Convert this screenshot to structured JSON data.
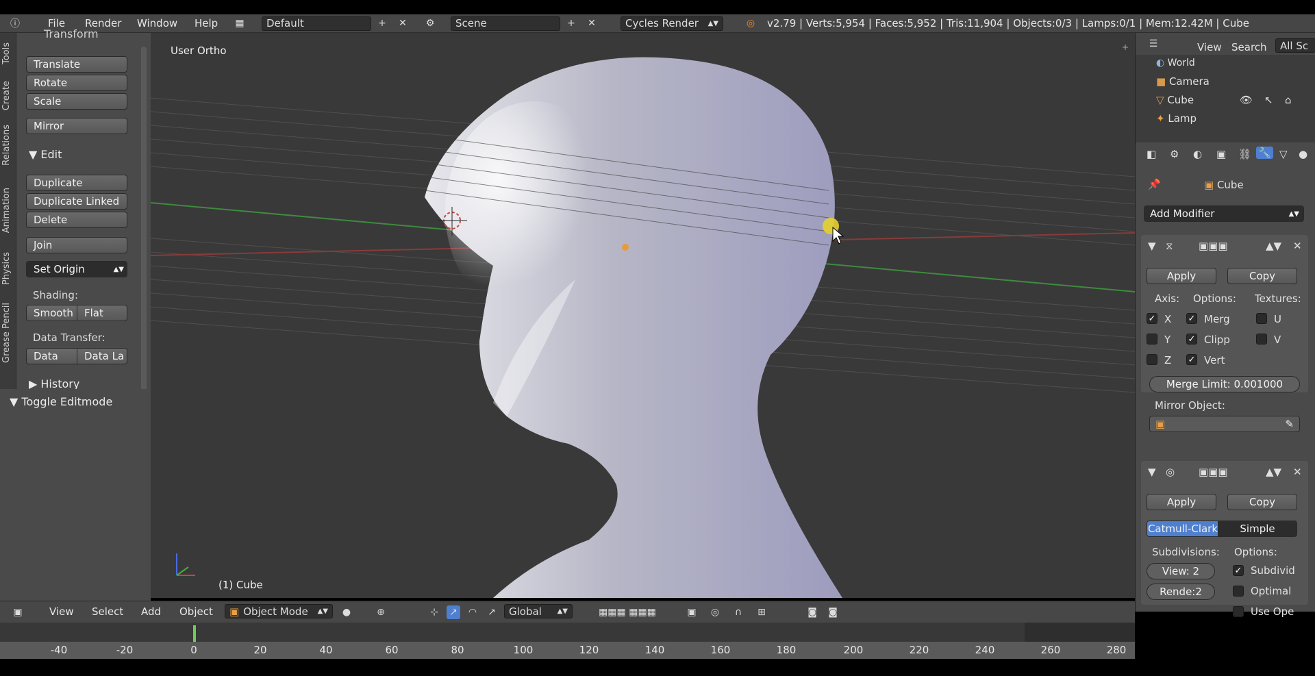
{
  "topbar": {
    "menus": [
      "File",
      "Render",
      "Window",
      "Help"
    ],
    "layout": "Default",
    "scene": "Scene",
    "engine": "Cycles Render",
    "stats": "v2.79 | Verts:5,954 | Faces:5,952 | Tris:11,904 | Objects:0/3 | Lamps:0/1 | Mem:12.42M | Cube"
  },
  "tabs": [
    "Tools",
    "Create",
    "Relations",
    "Animation",
    "Physics",
    "Grease Pencil"
  ],
  "tools": {
    "transform_header": "Transform",
    "translate": "Translate",
    "rotate": "Rotate",
    "scale": "Scale",
    "mirror": "Mirror",
    "edit_header": "Edit",
    "duplicate": "Duplicate",
    "duplicate_linked": "Duplicate Linked",
    "delete": "Delete",
    "join": "Join",
    "set_origin": "Set Origin",
    "shading_label": "Shading:",
    "smooth": "Smooth",
    "flat": "Flat",
    "data_transfer_label": "Data Transfer:",
    "data": "Data",
    "data_la": "Data La",
    "history": "History",
    "toggle_editmode": "Toggle Editmode"
  },
  "viewport": {
    "view_label": "User Ortho",
    "object_label": "(1) Cube"
  },
  "outliner": {
    "view": "View",
    "search": "Search",
    "all_scenes": "All Sc",
    "items": [
      "World",
      "Camera",
      "Cube",
      "Lamp"
    ]
  },
  "properties": {
    "object_name": "Cube",
    "add_modifier": "Add Modifier",
    "mirror_mod": {
      "apply": "Apply",
      "copy": "Copy",
      "axis_label": "Axis:",
      "options_label": "Options:",
      "textures_label": "Textures:",
      "x": "X",
      "y": "Y",
      "z": "Z",
      "merg": "Merg",
      "clipp": "Clipp",
      "vert": "Vert",
      "u": "U",
      "v": "V",
      "merge_limit": "Merge Limit: 0.001000",
      "mirror_object": "Mirror Object:"
    },
    "subsurf_mod": {
      "apply": "Apply",
      "copy": "Copy",
      "catmull": "Catmull-Clark",
      "simple": "Simple",
      "subdivisions_label": "Subdivisions:",
      "options_label": "Options:",
      "view": "View: 2",
      "render": "Rende:2",
      "subdivid": "Subdivid",
      "optimal": "Optimal",
      "use_ope": "Use Ope"
    }
  },
  "v3dheader": {
    "view": "View",
    "select": "Select",
    "add": "Add",
    "object": "Object",
    "mode": "Object Mode",
    "orientation": "Global"
  },
  "timeline": {
    "ticks": [
      "-40",
      "-20",
      "0",
      "20",
      "40",
      "60",
      "80",
      "100",
      "120",
      "140",
      "160",
      "180",
      "200",
      "220",
      "240",
      "260",
      "280"
    ],
    "current_frame": 1
  }
}
